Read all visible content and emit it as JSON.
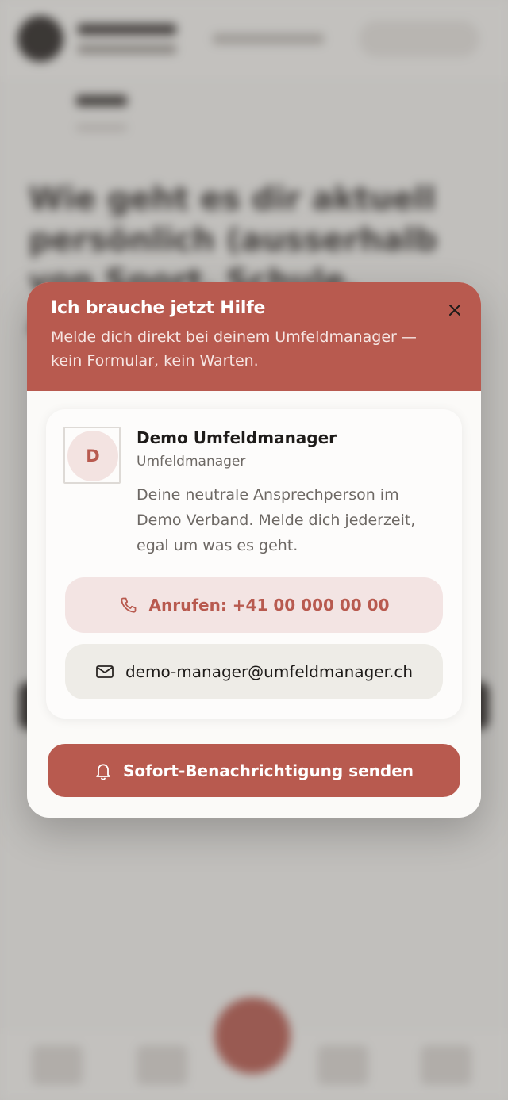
{
  "background": {
    "headline": "Wie geht es dir aktuell persönlich (ausserhalb von Sport, Schule, Ausbildung..."
  },
  "modal": {
    "title": "Ich brauche jetzt Hilfe",
    "subtitle": "Melde dich direkt bei deinem Umfeldmanager — kein Formular, kein Warten.",
    "contact": {
      "avatar_initial": "D",
      "name": "Demo Umfeldmanager",
      "role": "Umfeldmanager",
      "description": "Deine neutrale Ansprechperson im Demo Verband. Melde dich jederzeit, egal um was es geht.",
      "call_label": "Anrufen: +41 00 000 00 00",
      "email_label": "demo-manager@umfeldmanager.ch"
    },
    "notify_label": "Sofort-Benachrichtigung senden"
  },
  "icons": {
    "close": "close-icon",
    "phone": "phone-icon",
    "mail": "mail-icon",
    "bell": "bell-icon"
  },
  "colors": {
    "accent": "#b85a4f",
    "accent_soft": "#f3e4e3",
    "neutral_button": "#eeece7",
    "text_dark": "#1e1b19",
    "text_muted": "#6d6864"
  }
}
